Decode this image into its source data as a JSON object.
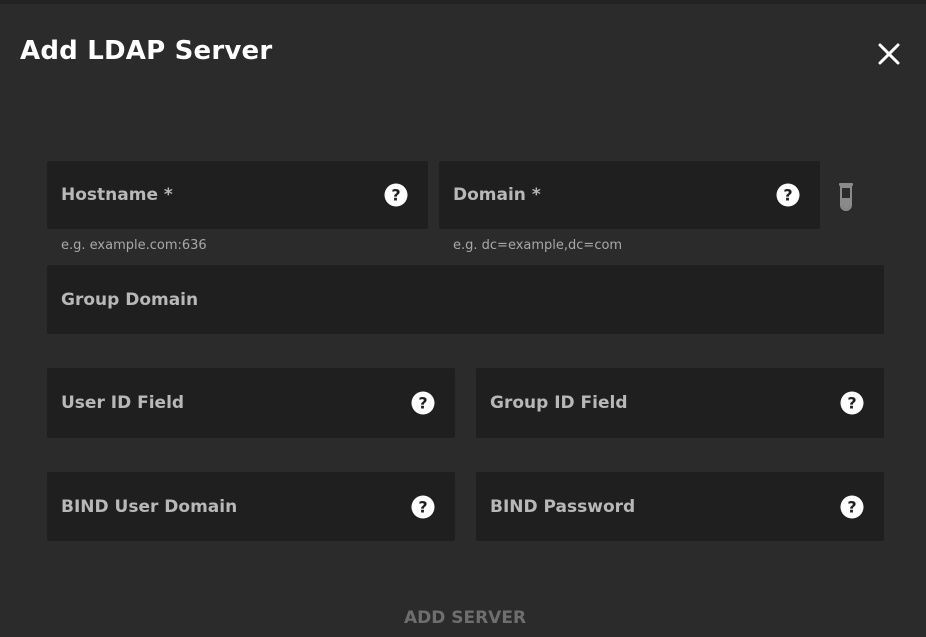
{
  "dialog": {
    "title": "Add LDAP Server",
    "close_icon": "close-icon"
  },
  "form": {
    "hostname": {
      "label": "Hostname *",
      "hint": "e.g. example.com:636",
      "value": ""
    },
    "domain": {
      "label": "Domain *",
      "hint": "e.g. dc=example,dc=com",
      "value": ""
    },
    "group_domain": {
      "label": "Group Domain",
      "value": ""
    },
    "user_id_field": {
      "label": "User ID Field",
      "value": ""
    },
    "group_id_field": {
      "label": "Group ID Field",
      "value": ""
    },
    "bind_user_domain": {
      "label": "BIND User Domain",
      "value": ""
    },
    "bind_password": {
      "label": "BIND Password",
      "value": ""
    },
    "test_icon": "beaker-icon",
    "help_icon": "help-icon"
  },
  "actions": {
    "submit_label": "ADD SERVER"
  },
  "colors": {
    "background": "#2b2b2b",
    "field_background": "#1f1f1f",
    "label": "#b8b8b8",
    "disabled_button": "#6e6e6e"
  }
}
